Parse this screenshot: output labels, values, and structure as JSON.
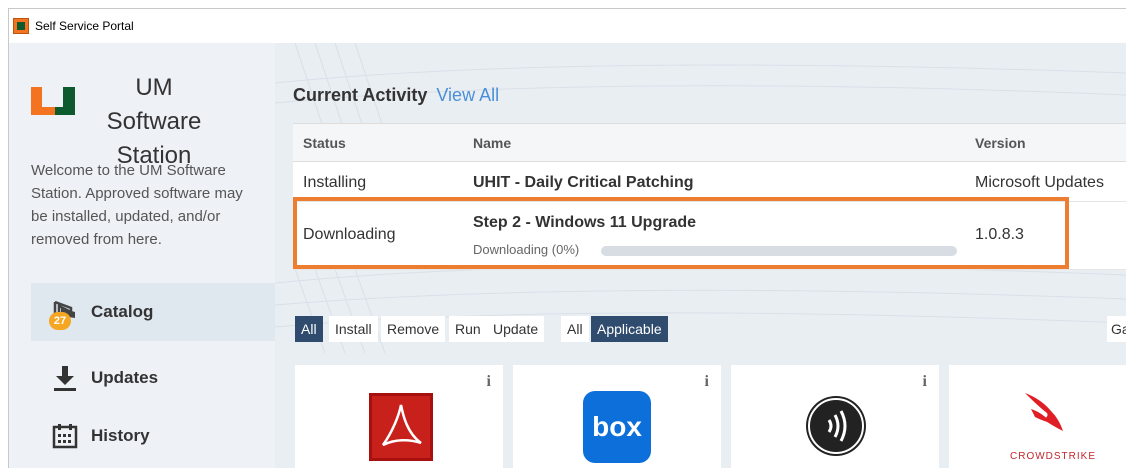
{
  "window": {
    "title": "Self Service Portal"
  },
  "sidebar": {
    "brand": "UM Software Station",
    "welcome": "Welcome to the UM Software Station. Approved software may be installed, updated, and/or removed from here.",
    "nav": [
      {
        "label": "Catalog",
        "icon": "catalog-icon",
        "badge": "27",
        "active": true
      },
      {
        "label": "Updates",
        "icon": "download-icon"
      },
      {
        "label": "History",
        "icon": "calendar-icon"
      }
    ]
  },
  "activity": {
    "title": "Current Activity",
    "view_all": "View All",
    "columns": [
      "Status",
      "Name",
      "Version"
    ],
    "rows": [
      {
        "status": "Installing",
        "name": "UHIT - Daily Critical Patching",
        "version": "Microsoft Updates"
      },
      {
        "status": "Downloading",
        "name": "Step 2 - Windows 11 Upgrade",
        "substatus": "Downloading (0%)",
        "version": "1.0.8.3",
        "progress": 0
      }
    ]
  },
  "filters": {
    "action": [
      "All",
      "Install",
      "Remove",
      "Run",
      "Update"
    ],
    "action_selected": "All",
    "scope": [
      "All",
      "Applicable"
    ],
    "scope_selected": "Applicable",
    "gallery_label": "Ga"
  },
  "tiles": [
    {
      "icon": "adobe-acrobat-icon",
      "info": "i"
    },
    {
      "icon": "box-icon",
      "label": "box",
      "info": "i"
    },
    {
      "icon": "nfc-icon",
      "info": "i"
    },
    {
      "icon": "crowdstrike-icon",
      "label": "CROWDSTRIKE"
    }
  ],
  "colors": {
    "highlight": "#ed7d31",
    "selected_filter": "#2f4b6e",
    "link": "#4a8fd8",
    "badge": "#f5a623"
  }
}
